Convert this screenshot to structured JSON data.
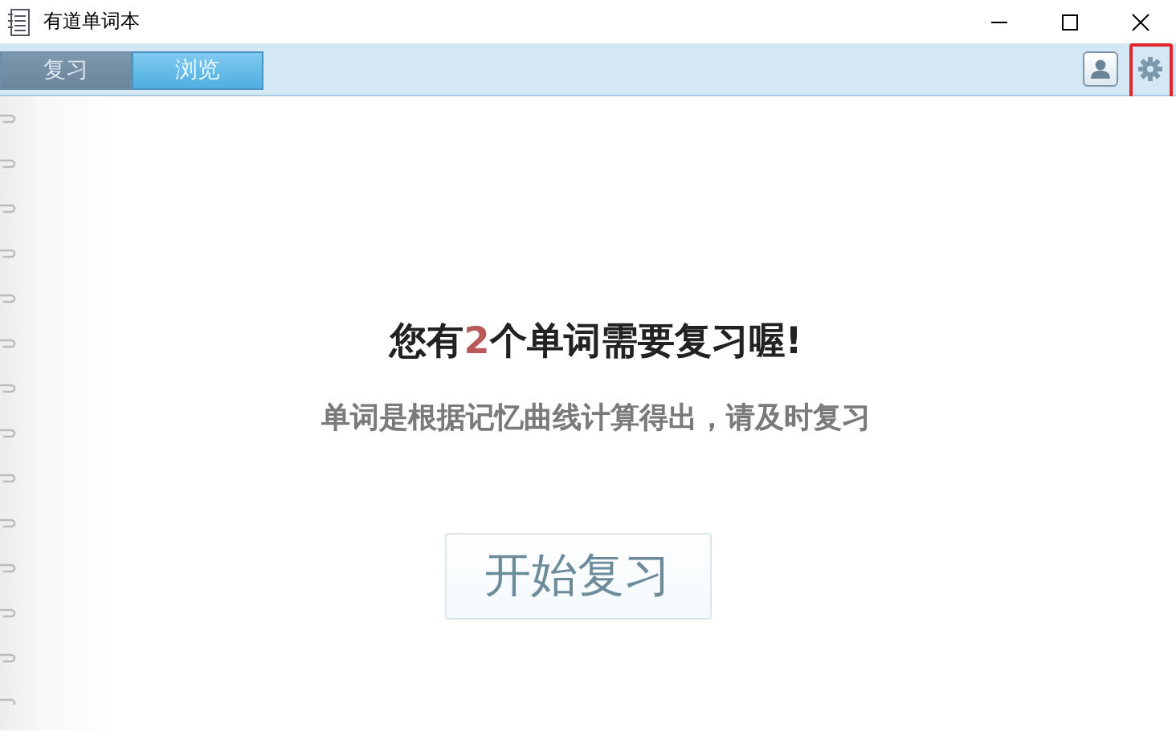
{
  "window": {
    "title": "有道单词本"
  },
  "tabs": [
    {
      "label": "复习",
      "selected": true
    },
    {
      "label": "浏览",
      "selected": false
    }
  ],
  "message": {
    "before": "您有",
    "count": "2",
    "after": "个单词需要复习喔!"
  },
  "subtitle": "单词是根据记忆曲线计算得出，请及时复习",
  "start_button": "开始复习"
}
